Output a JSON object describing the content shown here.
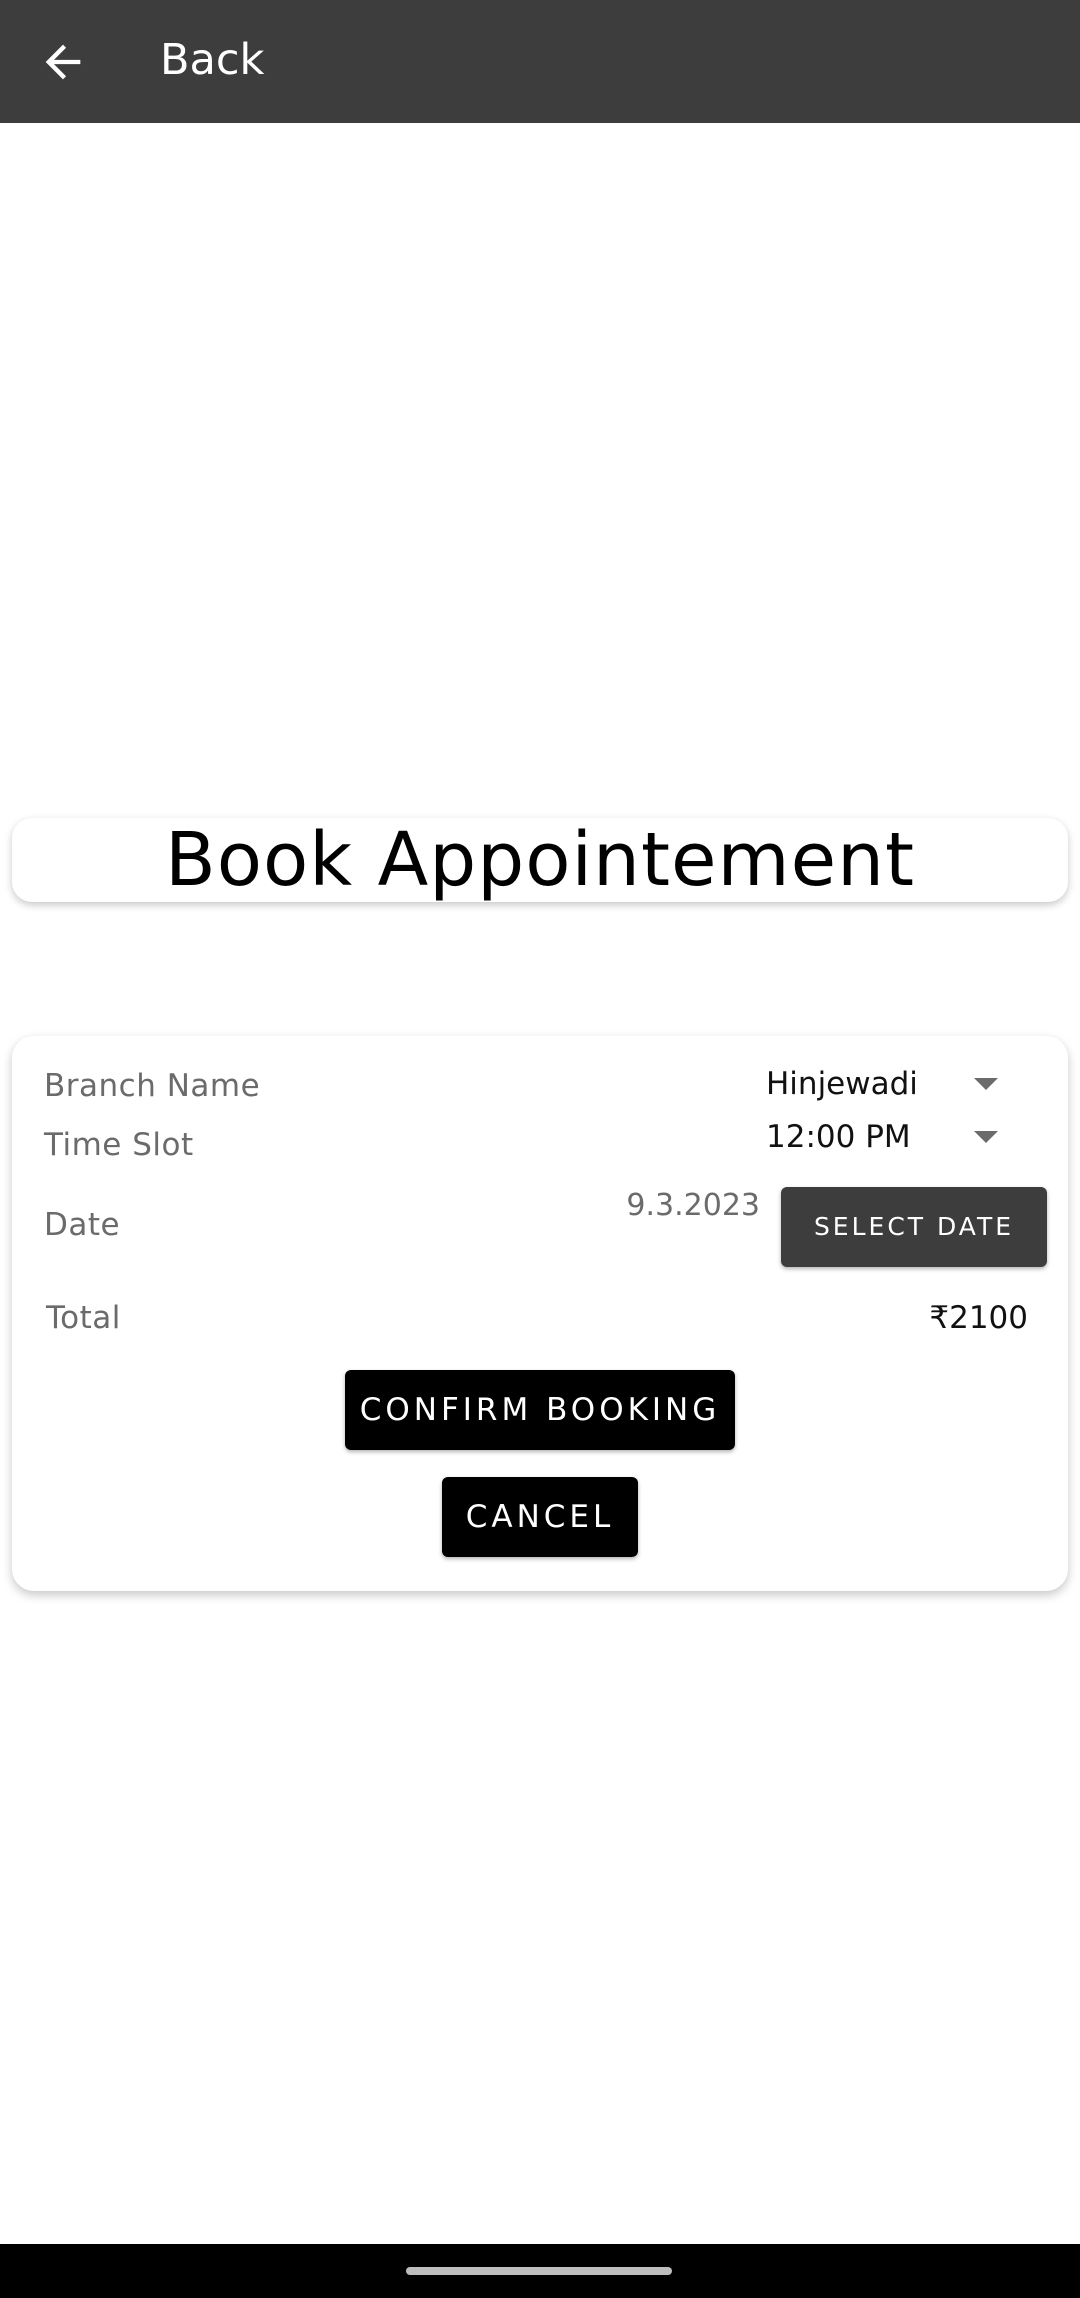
{
  "app_bar": {
    "back_label": "Back",
    "back_icon": "arrow-left-icon"
  },
  "title": "Book Appointement",
  "form": {
    "branch_label": "Branch Name",
    "branch_value": "Hinjewadi",
    "time_label": "Time Slot",
    "time_value": "12:00 PM",
    "date_label": "Date",
    "date_value": "9.3.2023",
    "select_date_label": "SELECT DATE",
    "total_label": "Total",
    "total_value": "₹2100",
    "confirm_label": "CONFIRM BOOKING",
    "cancel_label": "CANCEL",
    "caret_icon": "caret-down-icon"
  },
  "colors": {
    "app_bar": "#3d3d3d",
    "select_date_button": "#3d3d3d",
    "primary_button": "#000000",
    "label_text": "#6b6b6b"
  }
}
